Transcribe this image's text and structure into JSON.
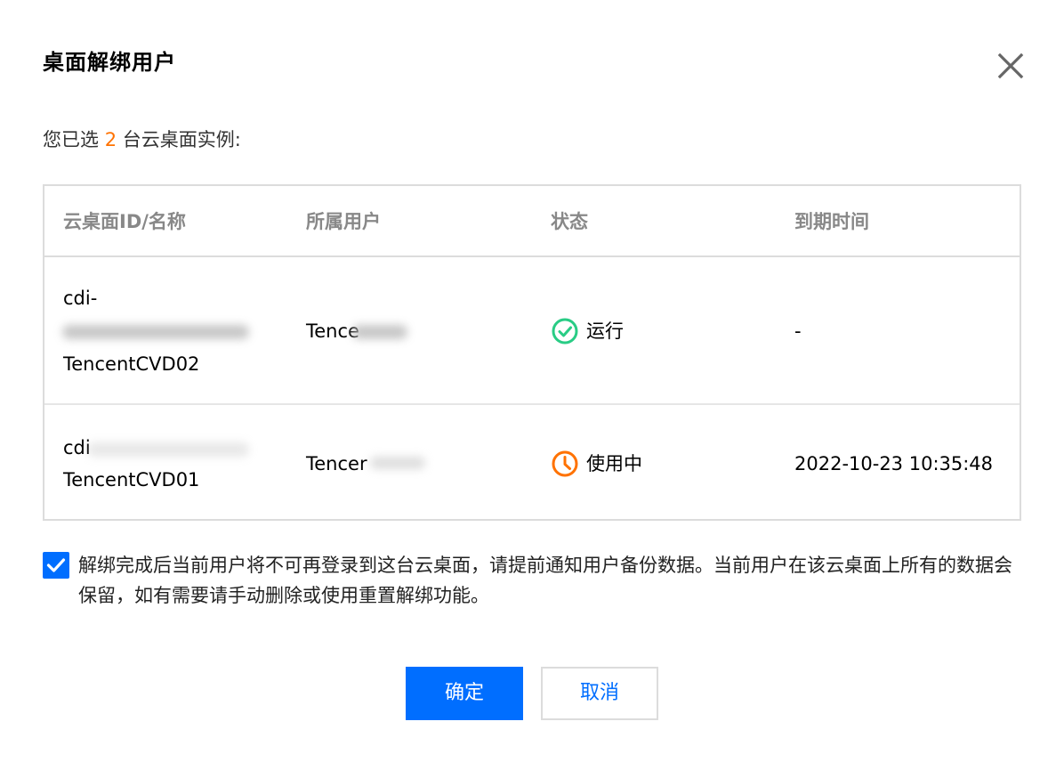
{
  "dialog": {
    "title": "桌面解绑用户",
    "close_icon": "close-icon"
  },
  "summary": {
    "prefix": "您已选 ",
    "count": "2",
    "suffix": " 台云桌面实例:"
  },
  "table": {
    "columns": [
      "云桌面ID/名称",
      "所属用户",
      "状态",
      "到期时间"
    ],
    "rows": [
      {
        "id": "cdi-",
        "name": "TencentCVD02",
        "user": "Tence",
        "status": "运行",
        "status_icon": "check-circle-icon",
        "status_color": "#29cc85",
        "expiry": "-"
      },
      {
        "id": "cdi",
        "name": "TencentCVD01",
        "user": "Tencer",
        "status": "使用中",
        "status_icon": "clock-icon",
        "status_color": "#ff7200",
        "expiry": "2022-10-23 10:35:48"
      }
    ]
  },
  "acknowledge": {
    "checked": true,
    "text": "解绑完成后当前用户将不可再登录到这台云桌面，请提前通知用户备份数据。当前用户在该云桌面上所有的数据会保留，如有需要请手动删除或使用重置解绑功能。"
  },
  "buttons": {
    "ok": "确定",
    "cancel": "取消"
  },
  "colors": {
    "primary": "#006eff",
    "accent_orange": "#ff7200",
    "success_green": "#29cc85"
  }
}
